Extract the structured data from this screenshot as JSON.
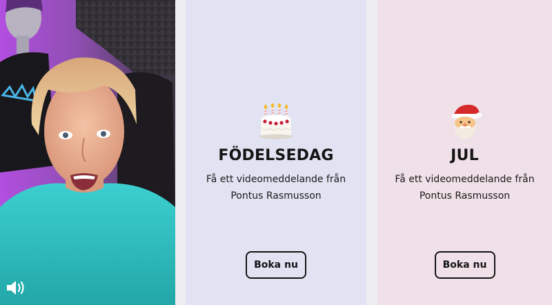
{
  "video": {
    "sound_icon": "speaker-volume-icon"
  },
  "cards": [
    {
      "icon": "birthday-cake-emoji",
      "title": "FÖDELSEDAG",
      "description": "Få ett videomeddelande från Pontus Rasmusson",
      "button_label": "Boka nu"
    },
    {
      "icon": "santa-claus-emoji",
      "title": "JUL",
      "description": "Få ett videomeddelande från Pontus Rasmusson",
      "button_label": "Boka nu"
    }
  ],
  "colors": {
    "page_background": "#ededf2",
    "birthday_card_background": "#e1e3f2",
    "christmas_card_background": "#f0e1e8",
    "text": "#141414"
  }
}
